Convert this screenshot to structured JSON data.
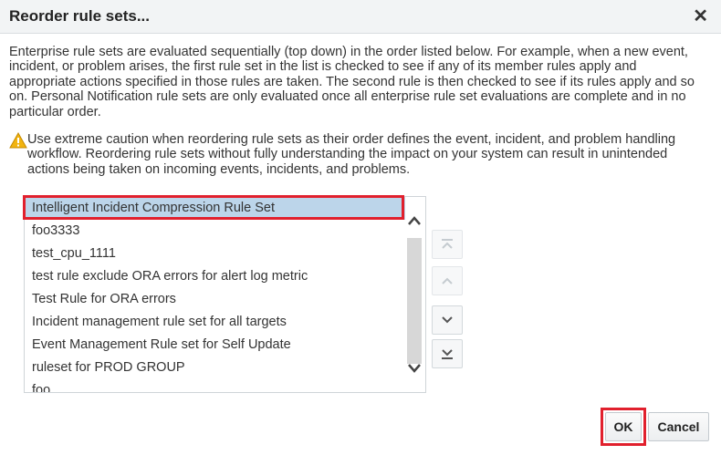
{
  "dialog": {
    "title": "Reorder rule sets...",
    "close_label": "✕",
    "description": "Enterprise rule sets are evaluated sequentially (top down) in the order listed below. For example, when a new event, incident, or problem arises, the first rule set in the list is checked to see if any of its member rules apply and appropriate actions specified in those rules are taken. The second rule is then checked to see if its rules apply and so on. Personal Notification rule sets are only evaluated once all enterprise rule set evaluations are complete and in no particular order.",
    "warning": "Use extreme caution when reordering rule sets as their order defines the event, incident, and problem handling workflow. Reordering rule sets without fully understanding the impact on your system can result in unintended actions being taken on incoming events, incidents, and problems."
  },
  "rule_sets": {
    "selected_index": 0,
    "items": [
      "Intelligent Incident Compression Rule Set",
      "foo3333",
      "test_cpu_1111",
      "test rule exclude ORA errors for alert log metric",
      "Test Rule for ORA errors",
      "Incident management rule set for all targets",
      "Event Management Rule set for Self Update",
      "ruleset for PROD GROUP",
      "foo"
    ]
  },
  "buttons": {
    "ok": "OK",
    "cancel": "Cancel"
  },
  "icons": {
    "warning": "warning-triangle-icon",
    "move_top": "move-to-top-icon",
    "move_up": "move-up-icon",
    "move_down": "move-down-icon",
    "move_bottom": "move-to-bottom-icon"
  },
  "colors": {
    "selection": "#bcd5ea",
    "highlight_border": "#e1202d",
    "warning": "#f2b40f"
  }
}
